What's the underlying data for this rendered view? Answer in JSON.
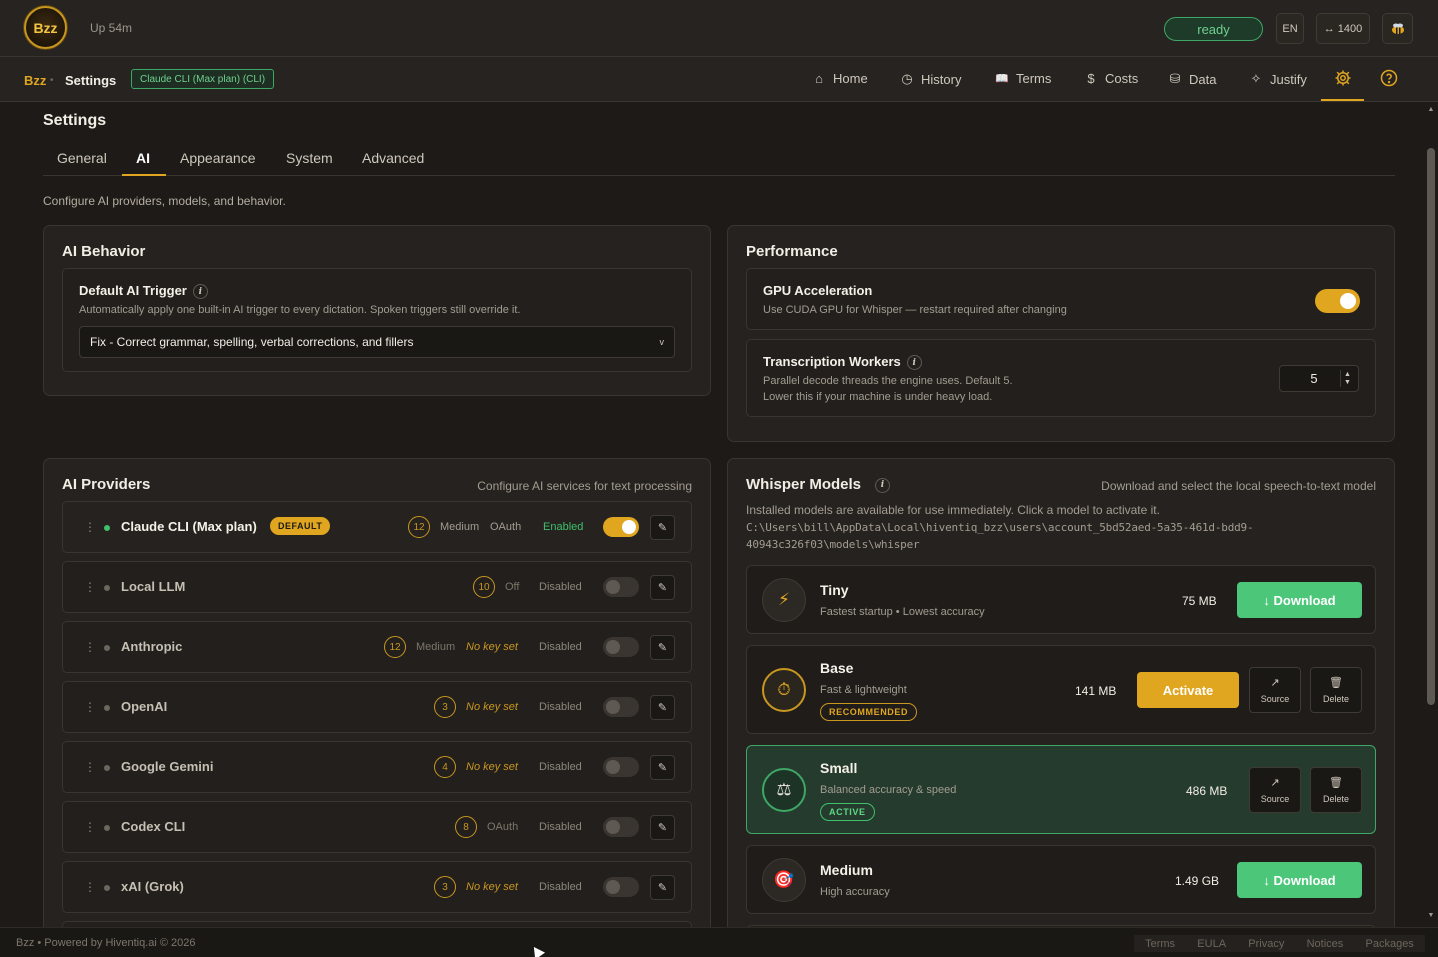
{
  "app": {
    "logo_text": "Bzz",
    "uptime": "Up 54m"
  },
  "topbar": {
    "status": "ready",
    "lang": "EN",
    "width": "↔ 1400",
    "bee_icon": "bee-icon"
  },
  "nav": {
    "brand": "Bzz",
    "separator": "•",
    "page": "Settings",
    "provider_badge": "Claude CLI (Max plan) (CLI)",
    "items": [
      {
        "label": "Home",
        "icon": "⌂"
      },
      {
        "label": "History",
        "icon": "◷"
      },
      {
        "label": "Terms",
        "icon": "📖"
      },
      {
        "label": "Costs",
        "icon": "$"
      },
      {
        "label": "Data",
        "icon": "⛁"
      },
      {
        "label": "Justify",
        "icon": "✧"
      }
    ]
  },
  "settings": {
    "title": "Settings",
    "tabs": [
      "General",
      "AI",
      "Appearance",
      "System",
      "Advanced"
    ],
    "active_tab": "AI",
    "description": "Configure AI providers, models, and behavior."
  },
  "ai_behavior": {
    "title": "AI Behavior",
    "trigger_title": "Default AI Trigger",
    "trigger_desc": "Automatically apply one built-in AI trigger to every dictation. Spoken triggers still override it.",
    "trigger_value": "Fix - Correct grammar, spelling, verbal corrections, and fillers"
  },
  "performance": {
    "title": "Performance",
    "gpu_title": "GPU Acceleration",
    "gpu_desc": "Use CUDA GPU for Whisper — restart required after changing",
    "gpu_enabled": true,
    "workers_title": "Transcription Workers",
    "workers_desc1": "Parallel decode threads the engine uses. Default 5.",
    "workers_desc2": "Lower this if your machine is under heavy load.",
    "workers_value": "5"
  },
  "providers": {
    "title": "AI Providers",
    "subtitle": "Configure AI services for text processing",
    "default_badge": "DEFAULT",
    "items": [
      {
        "name": "Claude CLI (Max plan)",
        "count": "12",
        "tier": "Medium",
        "auth": "OAuth",
        "status": "Enabled",
        "enabled": true
      },
      {
        "name": "Local LLM",
        "count": "10",
        "tier": "Off",
        "auth": "",
        "status": "Disabled",
        "enabled": false
      },
      {
        "name": "Anthropic",
        "count": "12",
        "tier": "Medium",
        "key": "No key set",
        "status": "Disabled",
        "enabled": false
      },
      {
        "name": "OpenAI",
        "count": "3",
        "key": "No key set",
        "status": "Disabled",
        "enabled": false
      },
      {
        "name": "Google Gemini",
        "count": "4",
        "key": "No key set",
        "status": "Disabled",
        "enabled": false
      },
      {
        "name": "Codex CLI",
        "count": "8",
        "auth": "OAuth",
        "status": "Disabled",
        "enabled": false
      },
      {
        "name": "xAI (Grok)",
        "count": "3",
        "key": "No key set",
        "status": "Disabled",
        "enabled": false
      }
    ]
  },
  "whisper": {
    "title": "Whisper Models",
    "subtitle": "Download and select the local speech-to-text model",
    "desc": "Installed models are available for use immediately. Click a model to activate it.",
    "path1": "C:\\Users\\bill\\AppData\\Local\\hiventiq_bzz\\users\\account_5bd52aed-5a35-461d-bdd9-",
    "path2": "40943c326f03\\models\\whisper",
    "download_label": "↓ Download",
    "activate_label": "Activate",
    "source_label": "Source",
    "delete_label": "Delete",
    "models": [
      {
        "name": "Tiny",
        "desc": "Fastest startup • Lowest accuracy",
        "size": "75 MB",
        "icon": "⚡"
      },
      {
        "name": "Base",
        "desc": "Fast & lightweight",
        "size": "141 MB",
        "badge": "RECOMMENDED",
        "icon": "⏱"
      },
      {
        "name": "Small",
        "desc": "Balanced accuracy & speed",
        "size": "486 MB",
        "badge": "ACTIVE",
        "icon": "⚖"
      },
      {
        "name": "Medium",
        "desc": "High accuracy",
        "size": "1.49 GB",
        "icon": "🎯"
      }
    ]
  },
  "footer": {
    "left": "Bzz • Powered by Hiventiq.ai © 2026",
    "links": [
      "Terms",
      "EULA",
      "Privacy",
      "Notices",
      "Packages"
    ]
  }
}
